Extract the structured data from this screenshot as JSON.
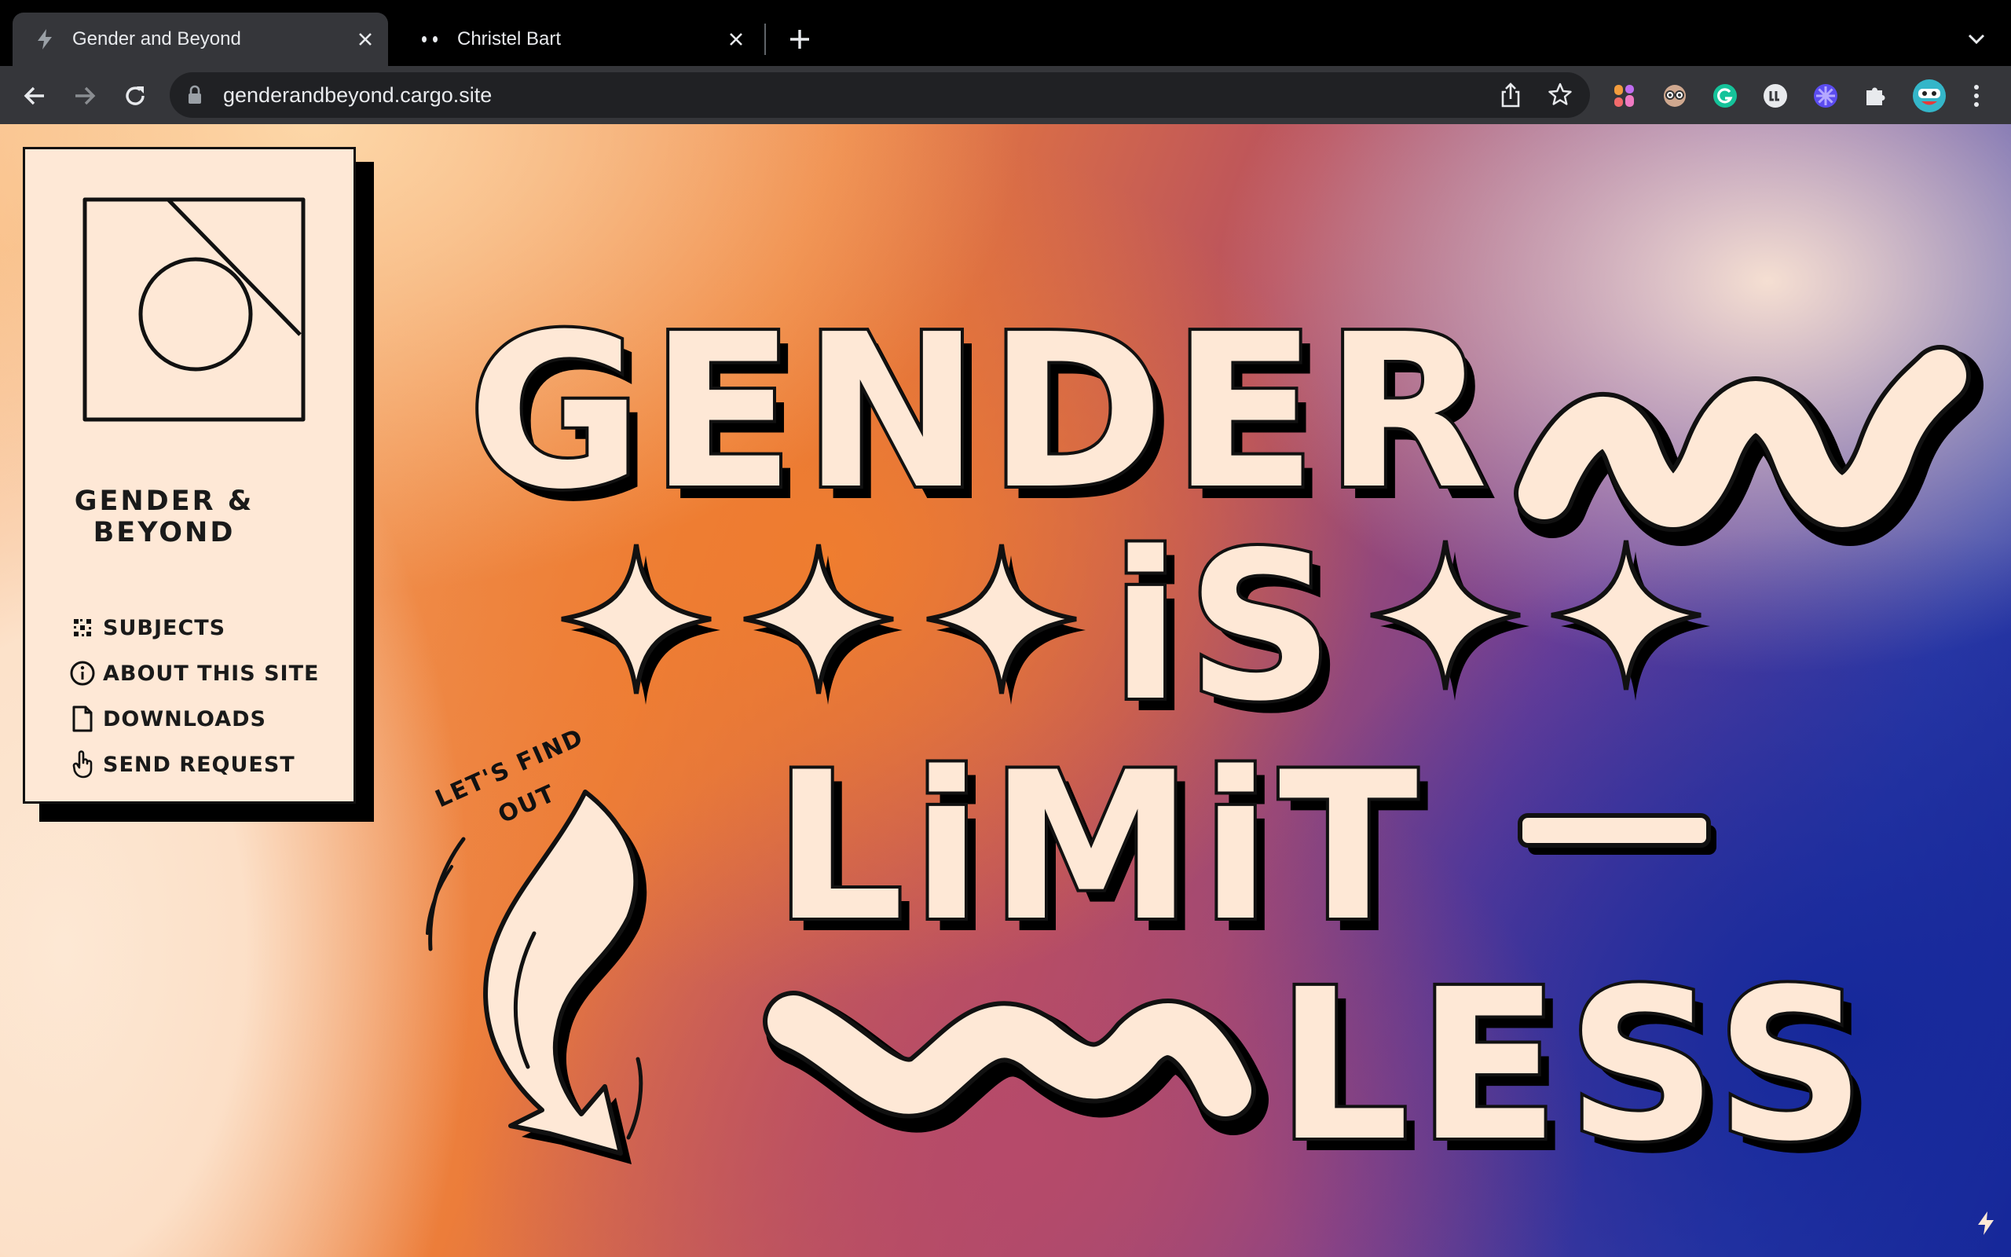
{
  "browser": {
    "tabs": [
      {
        "title": "Gender and Beyond",
        "active": true,
        "favicon": "bolt-icon"
      },
      {
        "title": "Christel Bart",
        "active": false,
        "favicon": "eyes-icon"
      }
    ],
    "url": "genderandbeyond.cargo.site"
  },
  "sidebar": {
    "title_line1": "GENDER &",
    "title_line2": "BEYOND",
    "menu": [
      {
        "label": "SUBJECTS",
        "icon": "dots-icon"
      },
      {
        "label": "ABOUT THIS SITE",
        "icon": "info-icon"
      },
      {
        "label": "DOWNLOADS",
        "icon": "file-icon"
      },
      {
        "label": "SEND REQUEST",
        "icon": "hand-icon"
      }
    ]
  },
  "hero": {
    "line1": "GENDER",
    "line2": "iS",
    "line3": "LiMiT",
    "line4": "LESS",
    "arrow_caption_1": "LET'S FIND",
    "arrow_caption_2": "OUT"
  },
  "colors": {
    "cream": "#fee8d6",
    "ink": "#111111",
    "chrome_dark": "#35363a",
    "orange": "#ec7d3a",
    "blue": "#16289a"
  }
}
